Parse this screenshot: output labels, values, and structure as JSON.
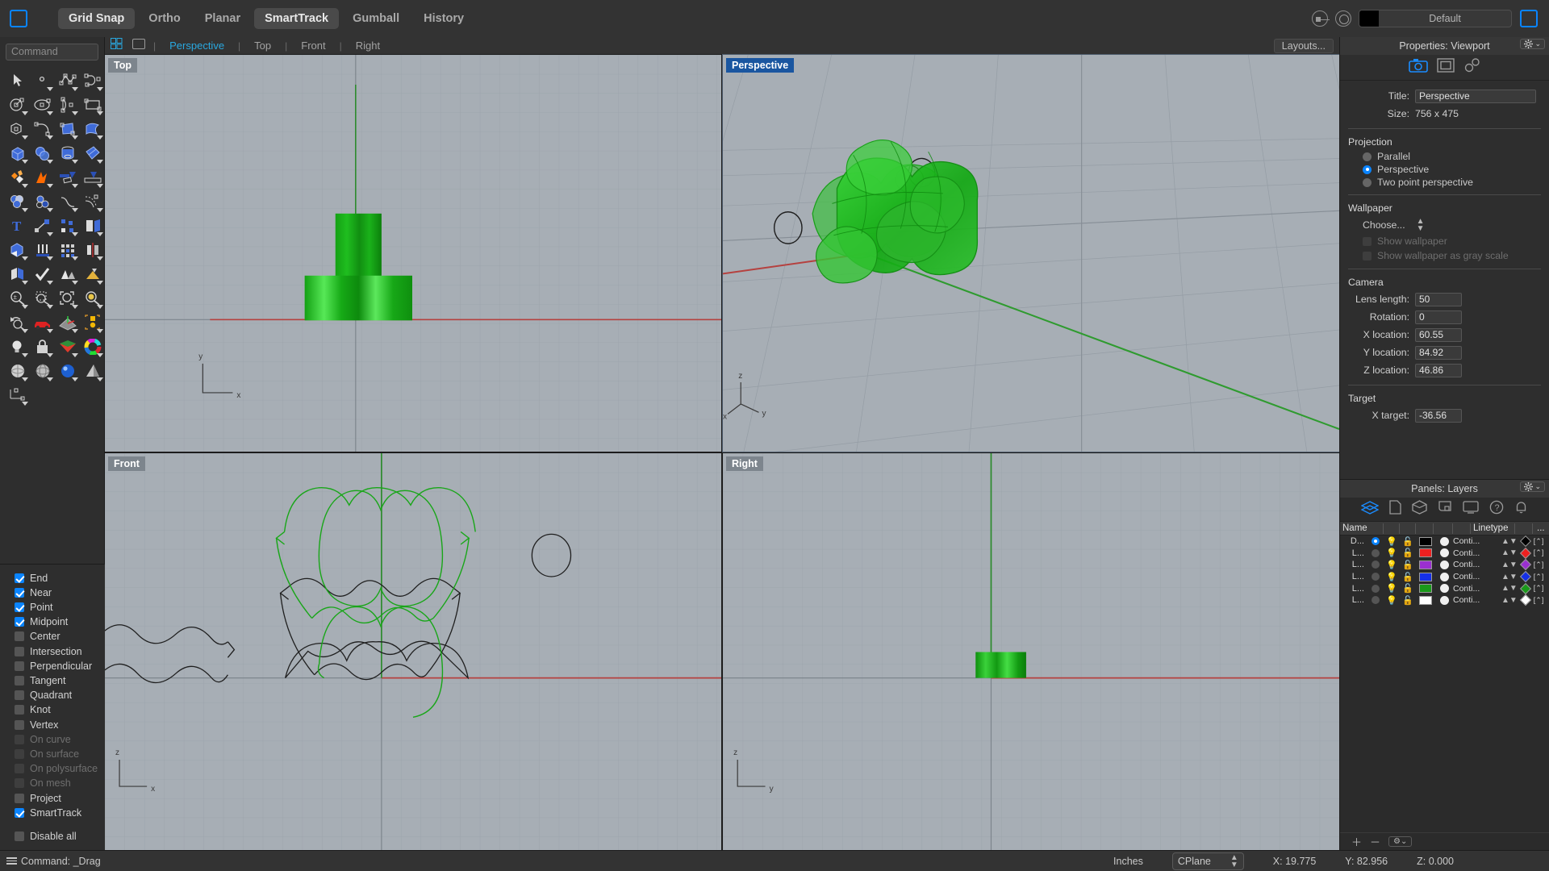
{
  "topbar": {
    "panel_toggle_left": "panel-toggle-left",
    "nav": [
      {
        "label": "Grid Snap",
        "active": true
      },
      {
        "label": "Ortho",
        "active": false
      },
      {
        "label": "Planar",
        "active": false
      },
      {
        "label": "SmartTrack",
        "active": true
      },
      {
        "label": "Gumball",
        "active": false
      },
      {
        "label": "History",
        "active": false
      }
    ],
    "layer_widget": {
      "swatch_color": "#000000",
      "layer_name": "Default"
    }
  },
  "command": {
    "placeholder": "Command",
    "value": ""
  },
  "viewport_tabs": {
    "layouts_label": "Layouts...",
    "tabs": [
      {
        "label": "Perspective",
        "active": true
      },
      {
        "label": "Top",
        "active": false
      },
      {
        "label": "Front",
        "active": false
      },
      {
        "label": "Right",
        "active": false
      }
    ]
  },
  "viewports": [
    {
      "label": "Top",
      "active": false
    },
    {
      "label": "Perspective",
      "active": true
    },
    {
      "label": "Front",
      "active": false
    },
    {
      "label": "Right",
      "active": false
    }
  ],
  "osnaps": [
    {
      "label": "End",
      "checked": true,
      "disabled": false
    },
    {
      "label": "Near",
      "checked": true,
      "disabled": false
    },
    {
      "label": "Point",
      "checked": true,
      "disabled": false
    },
    {
      "label": "Midpoint",
      "checked": true,
      "disabled": false
    },
    {
      "label": "Center",
      "checked": false,
      "disabled": false
    },
    {
      "label": "Intersection",
      "checked": false,
      "disabled": false
    },
    {
      "label": "Perpendicular",
      "checked": false,
      "disabled": false
    },
    {
      "label": "Tangent",
      "checked": false,
      "disabled": false
    },
    {
      "label": "Quadrant",
      "checked": false,
      "disabled": false
    },
    {
      "label": "Knot",
      "checked": false,
      "disabled": false
    },
    {
      "label": "Vertex",
      "checked": false,
      "disabled": false
    },
    {
      "label": "On curve",
      "checked": false,
      "disabled": true
    },
    {
      "label": "On surface",
      "checked": false,
      "disabled": true
    },
    {
      "label": "On polysurface",
      "checked": false,
      "disabled": true
    },
    {
      "label": "On mesh",
      "checked": false,
      "disabled": true
    },
    {
      "label": "Project",
      "checked": false,
      "disabled": false
    },
    {
      "label": "SmartTrack",
      "checked": true,
      "disabled": false
    },
    {
      "label": "Disable all",
      "checked": false,
      "disabled": false
    }
  ],
  "properties": {
    "header": "Properties: Viewport",
    "tabs": [
      "camera-icon",
      "viewport-display-icon",
      "links-icon"
    ],
    "title_label": "Title:",
    "title_value": "Perspective",
    "size_label": "Size:",
    "size_value": "756 x 475",
    "projection": {
      "heading": "Projection",
      "options": [
        {
          "label": "Parallel",
          "selected": false
        },
        {
          "label": "Perspective",
          "selected": true
        },
        {
          "label": "Two point perspective",
          "selected": false
        }
      ]
    },
    "wallpaper": {
      "heading": "Wallpaper",
      "choose_label": "Choose...",
      "show_wallpaper": {
        "label": "Show wallpaper",
        "checked": false
      },
      "show_gray": {
        "label": "Show wallpaper as gray scale",
        "checked": false
      }
    },
    "camera": {
      "heading": "Camera",
      "fields": [
        {
          "label": "Lens length:",
          "value": "50"
        },
        {
          "label": "Rotation:",
          "value": "0"
        },
        {
          "label": "X location:",
          "value": "60.55"
        },
        {
          "label": "Y location:",
          "value": "84.92"
        },
        {
          "label": "Z location:",
          "value": "46.86"
        }
      ]
    },
    "target": {
      "heading": "Target",
      "fields": [
        {
          "label": "X target:",
          "value": "-36.56"
        }
      ]
    }
  },
  "layers": {
    "header": "Panels: Layers",
    "columns": [
      "Name",
      "",
      "",
      "",
      "",
      "Linetype",
      "",
      "..."
    ],
    "rows": [
      {
        "name": "D...",
        "current": true,
        "color": "#000000",
        "linetype": "Conti...",
        "print_color": "#000000"
      },
      {
        "name": "L...",
        "current": false,
        "color": "#ee2020",
        "linetype": "Conti...",
        "print_color": "#ee2020"
      },
      {
        "name": "L...",
        "current": false,
        "color": "#9b2fd0",
        "linetype": "Conti...",
        "print_color": "#9b2fd0"
      },
      {
        "name": "L...",
        "current": false,
        "color": "#1530e8",
        "linetype": "Conti...",
        "print_color": "#1530e8"
      },
      {
        "name": "L...",
        "current": false,
        "color": "#1a9a1a",
        "linetype": "Conti...",
        "print_color": "#1a9a1a"
      },
      {
        "name": "L...",
        "current": false,
        "color": "#ffffff",
        "linetype": "Conti...",
        "print_color": "#ffffff"
      }
    ],
    "footer_buttons": [
      "add-layer",
      "remove-layer",
      "layer-options"
    ]
  },
  "statusbar": {
    "command_label": "Command: _Drag",
    "units": "Inches",
    "cplane": "CPlane",
    "x": "X: 19.775",
    "y": "Y: 82.956",
    "z": "Z: 0.000"
  }
}
